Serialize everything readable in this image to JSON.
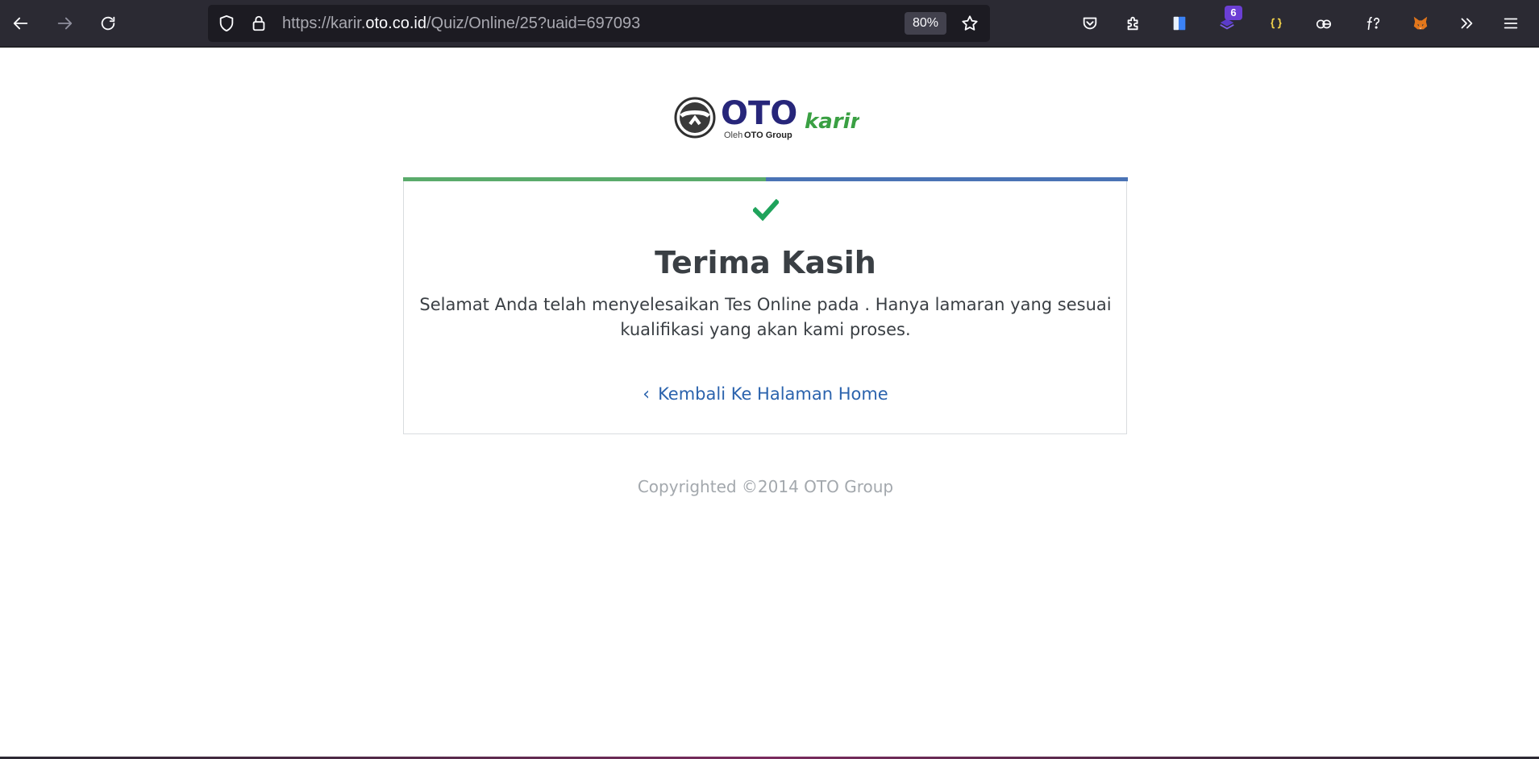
{
  "browser": {
    "url_prefix": "https://karir.",
    "url_host": "oto.co.id",
    "url_path": "/Quiz/Online/25?uaid=697093",
    "zoom": "80%",
    "extension_badge": "6",
    "colors": {
      "toolbar": "#2b2a33",
      "urlbar": "#1c1b22"
    }
  },
  "logo": {
    "brand": "OTO",
    "product": "karir",
    "tagline_prefix": "Oleh",
    "tagline_brand": "OTO Group",
    "colors": {
      "brand": "#27267a",
      "product": "#3aa043"
    }
  },
  "card": {
    "status_icon": "check-icon",
    "title": "Terima Kasih",
    "message": "Selamat Anda telah menyelesaikan Tes Online pada . Hanya lamaran yang sesuai kualifikasi yang akan kami proses.",
    "back_link": "Kembali Ke Halaman Home",
    "colors": {
      "stripe_left": "#5aab6b",
      "stripe_right": "#4a73b5",
      "check": "#1fa35b",
      "link": "#2b63ad"
    }
  },
  "footer": {
    "copyright": "Copyrighted ©2014 OTO Group"
  }
}
